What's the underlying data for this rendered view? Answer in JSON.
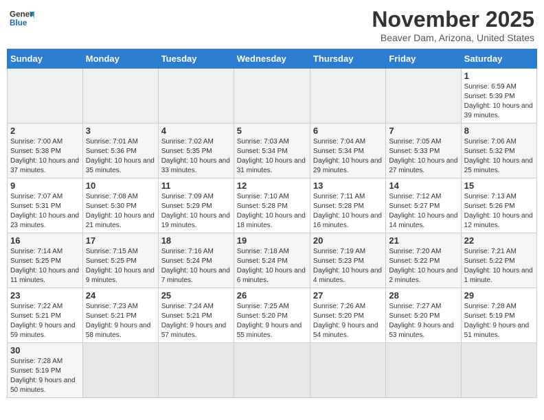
{
  "header": {
    "logo_general": "General",
    "logo_blue": "Blue",
    "month_title": "November 2025",
    "location": "Beaver Dam, Arizona, United States"
  },
  "weekdays": [
    "Sunday",
    "Monday",
    "Tuesday",
    "Wednesday",
    "Thursday",
    "Friday",
    "Saturday"
  ],
  "weeks": [
    [
      {
        "day": "",
        "info": ""
      },
      {
        "day": "",
        "info": ""
      },
      {
        "day": "",
        "info": ""
      },
      {
        "day": "",
        "info": ""
      },
      {
        "day": "",
        "info": ""
      },
      {
        "day": "",
        "info": ""
      },
      {
        "day": "1",
        "info": "Sunrise: 6:59 AM\nSunset: 5:39 PM\nDaylight: 10 hours and 39 minutes."
      }
    ],
    [
      {
        "day": "2",
        "info": "Sunrise: 7:00 AM\nSunset: 5:38 PM\nDaylight: 10 hours and 37 minutes."
      },
      {
        "day": "3",
        "info": "Sunrise: 7:01 AM\nSunset: 5:36 PM\nDaylight: 10 hours and 35 minutes."
      },
      {
        "day": "4",
        "info": "Sunrise: 7:02 AM\nSunset: 5:35 PM\nDaylight: 10 hours and 33 minutes."
      },
      {
        "day": "5",
        "info": "Sunrise: 7:03 AM\nSunset: 5:34 PM\nDaylight: 10 hours and 31 minutes."
      },
      {
        "day": "6",
        "info": "Sunrise: 7:04 AM\nSunset: 5:34 PM\nDaylight: 10 hours and 29 minutes."
      },
      {
        "day": "7",
        "info": "Sunrise: 7:05 AM\nSunset: 5:33 PM\nDaylight: 10 hours and 27 minutes."
      },
      {
        "day": "8",
        "info": "Sunrise: 7:06 AM\nSunset: 5:32 PM\nDaylight: 10 hours and 25 minutes."
      }
    ],
    [
      {
        "day": "9",
        "info": "Sunrise: 7:07 AM\nSunset: 5:31 PM\nDaylight: 10 hours and 23 minutes."
      },
      {
        "day": "10",
        "info": "Sunrise: 7:08 AM\nSunset: 5:30 PM\nDaylight: 10 hours and 21 minutes."
      },
      {
        "day": "11",
        "info": "Sunrise: 7:09 AM\nSunset: 5:29 PM\nDaylight: 10 hours and 19 minutes."
      },
      {
        "day": "12",
        "info": "Sunrise: 7:10 AM\nSunset: 5:28 PM\nDaylight: 10 hours and 18 minutes."
      },
      {
        "day": "13",
        "info": "Sunrise: 7:11 AM\nSunset: 5:28 PM\nDaylight: 10 hours and 16 minutes."
      },
      {
        "day": "14",
        "info": "Sunrise: 7:12 AM\nSunset: 5:27 PM\nDaylight: 10 hours and 14 minutes."
      },
      {
        "day": "15",
        "info": "Sunrise: 7:13 AM\nSunset: 5:26 PM\nDaylight: 10 hours and 12 minutes."
      }
    ],
    [
      {
        "day": "16",
        "info": "Sunrise: 7:14 AM\nSunset: 5:25 PM\nDaylight: 10 hours and 11 minutes."
      },
      {
        "day": "17",
        "info": "Sunrise: 7:15 AM\nSunset: 5:25 PM\nDaylight: 10 hours and 9 minutes."
      },
      {
        "day": "18",
        "info": "Sunrise: 7:16 AM\nSunset: 5:24 PM\nDaylight: 10 hours and 7 minutes."
      },
      {
        "day": "19",
        "info": "Sunrise: 7:18 AM\nSunset: 5:24 PM\nDaylight: 10 hours and 6 minutes."
      },
      {
        "day": "20",
        "info": "Sunrise: 7:19 AM\nSunset: 5:23 PM\nDaylight: 10 hours and 4 minutes."
      },
      {
        "day": "21",
        "info": "Sunrise: 7:20 AM\nSunset: 5:22 PM\nDaylight: 10 hours and 2 minutes."
      },
      {
        "day": "22",
        "info": "Sunrise: 7:21 AM\nSunset: 5:22 PM\nDaylight: 10 hours and 1 minute."
      }
    ],
    [
      {
        "day": "23",
        "info": "Sunrise: 7:22 AM\nSunset: 5:21 PM\nDaylight: 9 hours and 59 minutes."
      },
      {
        "day": "24",
        "info": "Sunrise: 7:23 AM\nSunset: 5:21 PM\nDaylight: 9 hours and 58 minutes."
      },
      {
        "day": "25",
        "info": "Sunrise: 7:24 AM\nSunset: 5:21 PM\nDaylight: 9 hours and 57 minutes."
      },
      {
        "day": "26",
        "info": "Sunrise: 7:25 AM\nSunset: 5:20 PM\nDaylight: 9 hours and 55 minutes."
      },
      {
        "day": "27",
        "info": "Sunrise: 7:26 AM\nSunset: 5:20 PM\nDaylight: 9 hours and 54 minutes."
      },
      {
        "day": "28",
        "info": "Sunrise: 7:27 AM\nSunset: 5:20 PM\nDaylight: 9 hours and 53 minutes."
      },
      {
        "day": "29",
        "info": "Sunrise: 7:28 AM\nSunset: 5:19 PM\nDaylight: 9 hours and 51 minutes."
      }
    ],
    [
      {
        "day": "30",
        "info": "Sunrise: 7:28 AM\nSunset: 5:19 PM\nDaylight: 9 hours and 50 minutes."
      },
      {
        "day": "",
        "info": ""
      },
      {
        "day": "",
        "info": ""
      },
      {
        "day": "",
        "info": ""
      },
      {
        "day": "",
        "info": ""
      },
      {
        "day": "",
        "info": ""
      },
      {
        "day": "",
        "info": ""
      }
    ]
  ]
}
